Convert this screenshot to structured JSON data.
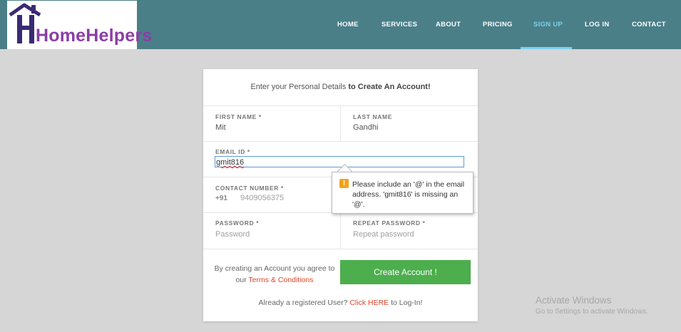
{
  "brand": {
    "name": "HomeHelpers"
  },
  "nav": {
    "items": [
      "HOME",
      "SERVICES",
      "ABOUT",
      "PRICING",
      "SIGN UP",
      "LOG IN",
      "CONTACT"
    ],
    "active": "SIGN UP"
  },
  "form": {
    "heading_prefix": "Enter your Personal Details ",
    "heading_bold": "to Create An Account!",
    "first_name": {
      "label": "FIRST NAME *",
      "value": "Mit"
    },
    "last_name": {
      "label": "LAST NAME",
      "value": "Gandhi"
    },
    "email": {
      "label": "EMAIL ID *",
      "value": "gmit816"
    },
    "contact": {
      "label": "CONTACT NUMBER *",
      "code": "+91",
      "value": "9409056375"
    },
    "password": {
      "label": "PASSWORD *",
      "placeholder": "Password"
    },
    "repeat_password": {
      "label": "REPEAT PASSWORD *",
      "placeholder": "Repeat password"
    },
    "agree_prefix": "By creating an Account you agree to our ",
    "agree_link": "Terms & Conditions",
    "submit_label": "Create Account !",
    "login_prefix": "Already a registered User? ",
    "login_link": "Click HERE",
    "login_suffix": " to Log-In!"
  },
  "validation": {
    "message": "Please include an '@' in the email address. 'gmit816' is missing an '@'."
  },
  "watermark": {
    "title": "Activate Windows",
    "subtitle": "Go to Settings to activate Windows."
  },
  "colors": {
    "header": "#4a7f88",
    "nav_active": "#7dd1ec",
    "button": "#4cae4c",
    "link": "#e0452b",
    "logo": "#8a3ea6",
    "warning": "#f2a21b"
  }
}
